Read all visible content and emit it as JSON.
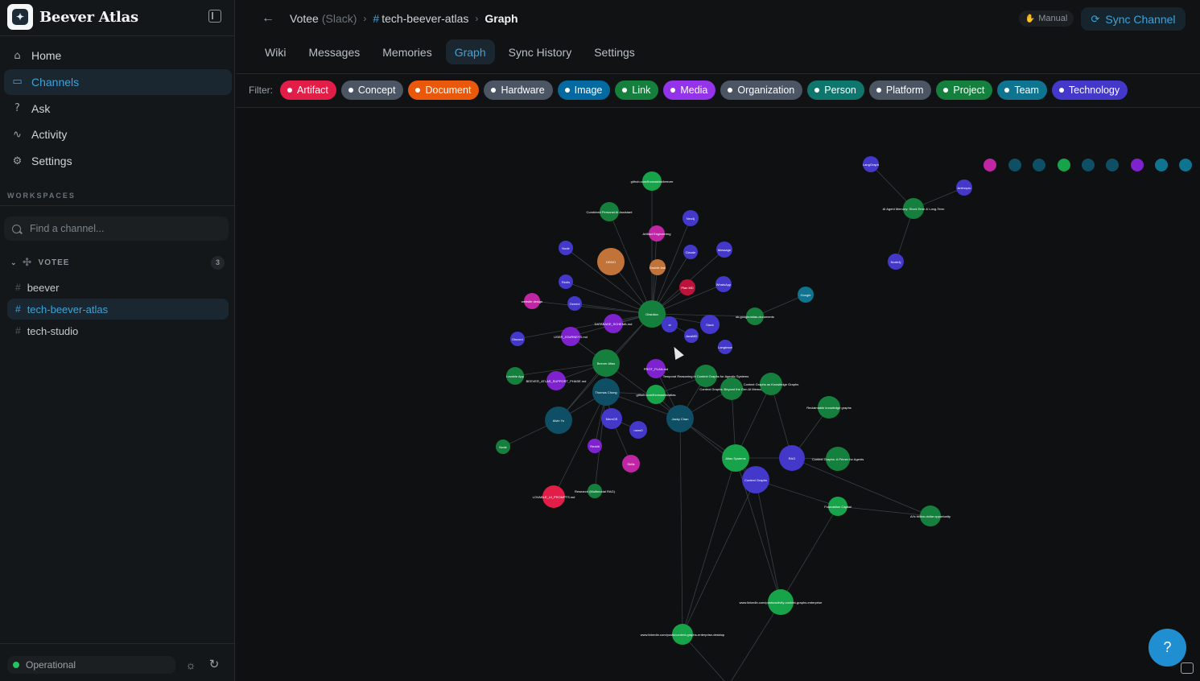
{
  "brand": {
    "name": "Beever Atlas",
    "logo_icon": "atlas-logo"
  },
  "nav": [
    {
      "label": "Home",
      "icon": "home-icon",
      "glyph": "⌂",
      "active": false
    },
    {
      "label": "Channels",
      "icon": "chat-icon",
      "glyph": "▭",
      "active": true
    },
    {
      "label": "Ask",
      "icon": "question-icon",
      "glyph": "?",
      "active": false
    },
    {
      "label": "Activity",
      "icon": "activity-icon",
      "glyph": "∿",
      "active": false
    },
    {
      "label": "Settings",
      "icon": "gear-icon",
      "glyph": "⚙",
      "active": false
    }
  ],
  "workspaces_label": "WORKSPACES",
  "search": {
    "placeholder": "Find a channel..."
  },
  "workspace": {
    "name": "VOTEE",
    "count": "3"
  },
  "channels": [
    {
      "name": "beever",
      "active": false
    },
    {
      "name": "tech-beever-atlas",
      "active": true
    },
    {
      "name": "tech-studio",
      "active": false
    }
  ],
  "status": {
    "label": "Operational",
    "color": "#22c55e"
  },
  "breadcrumb": {
    "workspace": "Votee",
    "workspace_type": "(Slack)",
    "channel": "tech-beever-atlas",
    "page": "Graph"
  },
  "manual_label": "Manual",
  "sync_label": "Sync Channel",
  "tabs": [
    {
      "label": "Wiki",
      "active": false
    },
    {
      "label": "Messages",
      "active": false
    },
    {
      "label": "Memories",
      "active": false
    },
    {
      "label": "Graph",
      "active": true
    },
    {
      "label": "Sync History",
      "active": false
    },
    {
      "label": "Settings",
      "active": false
    }
  ],
  "filter": {
    "label": "Filter:",
    "chips": [
      {
        "label": "Artifact",
        "color": "#e11d48"
      },
      {
        "label": "Concept",
        "color": "#4b5563"
      },
      {
        "label": "Document",
        "color": "#ea580c"
      },
      {
        "label": "Hardware",
        "color": "#4b5563"
      },
      {
        "label": "Image",
        "color": "#0369a1"
      },
      {
        "label": "Link",
        "color": "#15803d"
      },
      {
        "label": "Media",
        "color": "#9333ea"
      },
      {
        "label": "Organization",
        "color": "#4b5563"
      },
      {
        "label": "Person",
        "color": "#0f766e"
      },
      {
        "label": "Platform",
        "color": "#4b5563"
      },
      {
        "label": "Project",
        "color": "#15803d"
      },
      {
        "label": "Team",
        "color": "#0e7490"
      },
      {
        "label": "Technology",
        "color": "#4338ca"
      }
    ]
  },
  "graph": {
    "nodes": [
      {
        "id": "n1",
        "label": "github.com/thomasfan/beever",
        "color": "#16a34a"
      },
      {
        "id": "n2",
        "label": "Combined Personal AI Assistant",
        "color": "#15803d"
      },
      {
        "id": "n3",
        "label": "Artifact Engineering",
        "color": "#c026a3"
      },
      {
        "id": "n4",
        "label": "Neo4j",
        "color": "#4338ca"
      },
      {
        "id": "n5",
        "label": "Node",
        "color": "#4338ca"
      },
      {
        "id": "n6",
        "label": "DEMO",
        "color": "#c2733a"
      },
      {
        "id": "n7",
        "label": "Claude",
        "color": "#4338ca"
      },
      {
        "id": "n8",
        "label": "Message",
        "color": "#4338ca"
      },
      {
        "id": "n9",
        "label": "Double Ask",
        "color": "#c2733a"
      },
      {
        "id": "n10",
        "label": "Redis",
        "color": "#4338ca"
      },
      {
        "id": "n11",
        "label": "Plan MD",
        "color": "#be123c"
      },
      {
        "id": "n12",
        "label": "WhatsApp",
        "color": "#4338ca"
      },
      {
        "id": "n13",
        "label": "website design",
        "color": "#c026a3"
      },
      {
        "id": "n14",
        "label": "Gemini",
        "color": "#4338ca"
      },
      {
        "id": "n15",
        "label": "Obsidian",
        "color": "#15803d"
      },
      {
        "id": "n16",
        "label": "Google",
        "color": "#0e7490"
      },
      {
        "id": "n17",
        "label": "DATABASE_SCHEMA.md",
        "color": "#7e22ce"
      },
      {
        "id": "n18",
        "label": "ai",
        "color": "#4338ca"
      },
      {
        "id": "n19",
        "label": "Slack",
        "color": "#4338ca"
      },
      {
        "id": "n20",
        "label": "JavaMD",
        "color": "#4338ca"
      },
      {
        "id": "n21",
        "label": "sk-google/atlas-documents",
        "color": "#15803d"
      },
      {
        "id": "n22",
        "label": "Discord",
        "color": "#4338ca"
      },
      {
        "id": "n23",
        "label": "USER_JOURNEYS.md",
        "color": "#7e22ce"
      },
      {
        "id": "n24",
        "label": "Langtrace",
        "color": "#4338ca"
      },
      {
        "id": "n25",
        "label": "Temporal Reasoning in Context Graphs for Agentic Systems",
        "color": "#15803d"
      },
      {
        "id": "n26",
        "label": "Beever Atlas",
        "color": "#15803d"
      },
      {
        "id": "n27",
        "label": "PROT_PLAN.md",
        "color": "#7e22ce"
      },
      {
        "id": "n28",
        "label": "Context Graphs: Beyond the Gen AI Memory",
        "color": "#15803d"
      },
      {
        "id": "n29",
        "label": "Context Graphs as Knowledge Graphs",
        "color": "#15803d"
      },
      {
        "id": "n30",
        "label": "Lovable App",
        "color": "#15803d"
      },
      {
        "id": "n31",
        "label": "BEEVER_ATLAS_SUPPORT_PHASE.md",
        "color": "#7e22ce"
      },
      {
        "id": "n32",
        "label": "Thomas Chong",
        "color": "#0e4f66"
      },
      {
        "id": "n33",
        "label": "github.com/thomasfan/atlas",
        "color": "#16a34a"
      },
      {
        "id": "n34",
        "label": "Alvin Yu",
        "color": "#0e4f66"
      },
      {
        "id": "n35",
        "label": "Jacky Chan",
        "color": "#0e4f66"
      },
      {
        "id": "n36",
        "label": "MemOS",
        "color": "#4338ca"
      },
      {
        "id": "n37",
        "label": "mem0",
        "color": "#4338ca"
      },
      {
        "id": "n38",
        "label": "Reclaimable knowledge graphs",
        "color": "#15803d"
      },
      {
        "id": "n39",
        "label": "Node",
        "color": "#15803d"
      },
      {
        "id": "n40",
        "label": "Reddit",
        "color": "#7e22ce"
      },
      {
        "id": "n41",
        "label": "Atlas Systems",
        "color": "#16a34a"
      },
      {
        "id": "n42",
        "label": "RAG",
        "color": "#4338ca"
      },
      {
        "id": "n43",
        "label": "Context Graphs: A Primer for Agents",
        "color": "#15803d"
      },
      {
        "id": "n44",
        "label": "Skills",
        "color": "#c026a3"
      },
      {
        "id": "n45",
        "label": "Context Graphs",
        "color": "#4338ca"
      },
      {
        "id": "n46",
        "label": "LOVABLE_UI_PROMPTS.md",
        "color": "#e11d48"
      },
      {
        "id": "n47",
        "label": "Research (Multimodal RAG)",
        "color": "#15803d"
      },
      {
        "id": "n48",
        "label": "Foundation Capital",
        "color": "#16a34a"
      },
      {
        "id": "n49",
        "label": "AI's trillion-dollar opportunity",
        "color": "#15803d"
      },
      {
        "id": "n50",
        "label": "www.linkedin.com/posts/activity-context-graphs-enterprise",
        "color": "#16a34a"
      },
      {
        "id": "n51",
        "label": "www.linkedin.com/posts/context-graphs-enterprise-desktop",
        "color": "#16a34a"
      },
      {
        "id": "n52",
        "label": "LangGraph",
        "color": "#4338ca"
      },
      {
        "id": "n53",
        "label": "AI Agent Memory: Short-Term & Long-Term",
        "color": "#15803d"
      },
      {
        "id": "n54",
        "label": "Anthropic",
        "color": "#4338ca"
      },
      {
        "id": "n55",
        "label": "Node4j",
        "color": "#4338ca"
      }
    ]
  }
}
